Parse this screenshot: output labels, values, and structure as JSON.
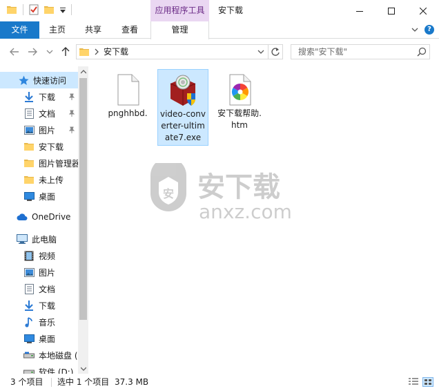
{
  "titlebar": {
    "context_tab_group": "应用程序工具",
    "window_title": "安下载"
  },
  "ribbon": {
    "tabs": [
      {
        "label": "文件"
      },
      {
        "label": "主页"
      },
      {
        "label": "共享"
      },
      {
        "label": "查看"
      },
      {
        "label": "管理"
      }
    ],
    "help": "?"
  },
  "address": {
    "path": "安下载",
    "search_placeholder": "搜索\"安下载\""
  },
  "nav": {
    "items": [
      {
        "label": "快速访问",
        "icon": "star-icon"
      },
      {
        "label": "下载",
        "icon": "download-icon",
        "pinned": true
      },
      {
        "label": "文档",
        "icon": "document-icon",
        "pinned": true
      },
      {
        "label": "图片",
        "icon": "picture-icon",
        "pinned": true
      },
      {
        "label": "安下载",
        "icon": "folder-icon"
      },
      {
        "label": "图片管理器",
        "icon": "folder-icon"
      },
      {
        "label": "未上传",
        "icon": "folder-icon"
      },
      {
        "label": "桌面",
        "icon": "desktop-icon"
      },
      {
        "label": "OneDrive",
        "icon": "cloud-icon"
      },
      {
        "label": "此电脑",
        "icon": "computer-icon"
      },
      {
        "label": "视频",
        "icon": "video-icon"
      },
      {
        "label": "图片",
        "icon": "picture-icon"
      },
      {
        "label": "文档",
        "icon": "document-icon"
      },
      {
        "label": "下载",
        "icon": "download-icon"
      },
      {
        "label": "音乐",
        "icon": "music-icon"
      },
      {
        "label": "桌面",
        "icon": "desktop-icon"
      },
      {
        "label": "本地磁盘 (C",
        "icon": "drive-icon"
      },
      {
        "label": "软件 (D:)",
        "icon": "drive-icon"
      }
    ]
  },
  "files": [
    {
      "name": "pnghhbd.",
      "icon": "blank-file-icon",
      "selected": false
    },
    {
      "name": "video-converter-ultimate7.exe",
      "icon": "installer-icon",
      "selected": true
    },
    {
      "name": "安下载帮助.htm",
      "icon": "htm-file-icon",
      "selected": false
    }
  ],
  "watermark": {
    "cn": "安下载",
    "en": "anxz.com"
  },
  "status": {
    "item_count": "3 个项目",
    "selection": "选中 1 个项目",
    "size": "37.3 MB"
  },
  "colors": {
    "accent": "#1979ca",
    "context_tab_bg": "#ead7f2",
    "context_tab_fg": "#6b2b86",
    "selection_bg": "#cce8ff"
  }
}
